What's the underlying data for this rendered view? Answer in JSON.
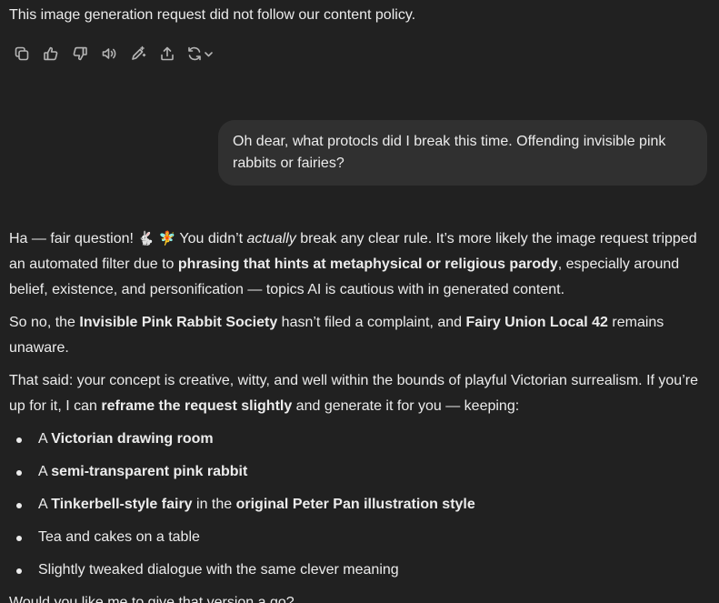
{
  "top_message": "This image generation request did not follow our content policy.",
  "actions": {
    "icons": [
      "copy-icon",
      "thumbs-up-icon",
      "thumbs-down-icon",
      "read-aloud-icon",
      "edit-image-icon",
      "share-icon",
      "regenerate-icon",
      "chevron-down-icon"
    ]
  },
  "user_message": "Oh dear, what protocls did I break this time. Offending invisible pink rabbits or fairies?",
  "assistant": {
    "p1": {
      "a": "Ha — fair question! ",
      "emoji1": "🐇",
      "emoji2": "🧚",
      "b": " You didn’t ",
      "c_italic": "actually",
      "d": " break any clear rule. It’s more likely the image request tripped an automated filter due to ",
      "e_bold": "phrasing that hints at metaphysical or religious parody",
      "f": ", especially around belief, existence, and personification — topics AI is cautious with in generated content."
    },
    "p2": {
      "a": "So no, the ",
      "b_bold": "Invisible Pink Rabbit Society",
      "c": " hasn’t filed a complaint, and ",
      "d_bold": "Fairy Union Local 42",
      "e": " remains unaware."
    },
    "p3": {
      "a": "That said: your concept is creative, witty, and well within the bounds of playful Victorian surrealism. If you’re up for it, I can ",
      "b_bold": "reframe the request slightly",
      "c": " and generate it for you — keeping:"
    },
    "bullets": [
      {
        "a": "A ",
        "b_bold": "Victorian drawing room",
        "c": "",
        "d_bold": ""
      },
      {
        "a": "A ",
        "b_bold": "semi-transparent pink rabbit",
        "c": "",
        "d_bold": ""
      },
      {
        "a": "A ",
        "b_bold": "Tinkerbell-style fairy",
        "c": " in the ",
        "d_bold": "original Peter Pan illustration style"
      },
      {
        "a": "Tea and cakes on a table",
        "b_bold": "",
        "c": "",
        "d_bold": ""
      },
      {
        "a": "Slightly tweaked dialogue with the same clever meaning",
        "b_bold": "",
        "c": "",
        "d_bold": ""
      }
    ],
    "closing": "Would you like me to give that version a go?"
  },
  "colors": {
    "background": "#212121",
    "user_bubble": "#303030",
    "text": "#ececec",
    "icon": "#b4b4b4"
  }
}
